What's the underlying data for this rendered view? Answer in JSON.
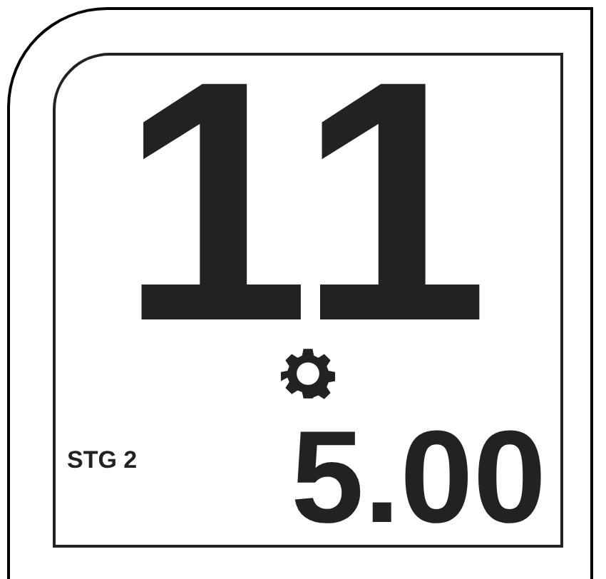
{
  "display": {
    "main_reading": "11",
    "mode_label": "STG 2",
    "sub_reading": "5.00"
  }
}
